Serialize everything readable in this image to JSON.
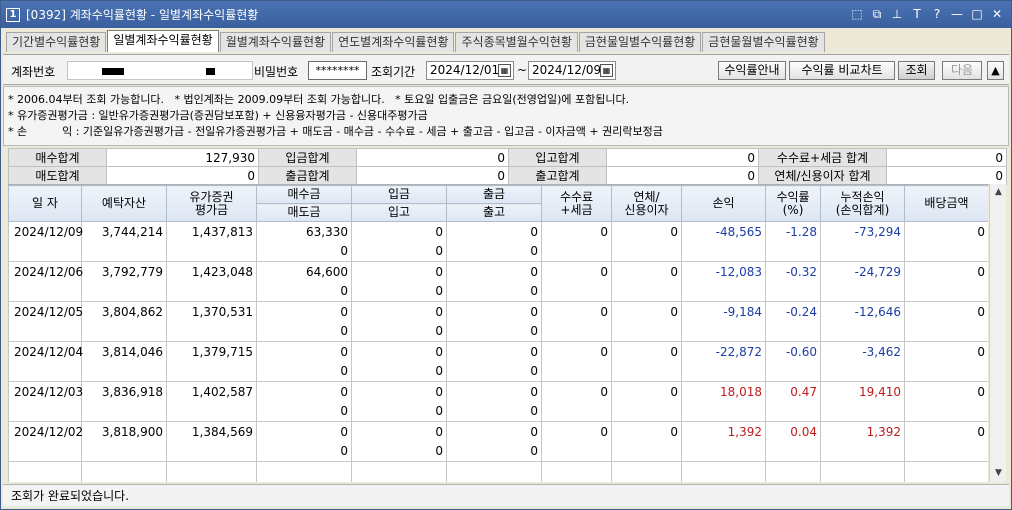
{
  "window": {
    "number": "1",
    "title": "[0392] 계좌수익률현황 - 일별계좌수익률현황",
    "buttons": [
      "⬚",
      "⧉",
      "⊥",
      "T",
      "?",
      "—",
      "□",
      "✕"
    ]
  },
  "tabs": [
    {
      "label": "기간별수익률현황",
      "active": false
    },
    {
      "label": "일별계좌수익률현황",
      "active": true
    },
    {
      "label": "월별계좌수익률현황",
      "active": false
    },
    {
      "label": "연도별계좌수익률현황",
      "active": false
    },
    {
      "label": "주식종목별월수익현황",
      "active": false
    },
    {
      "label": "금현물일별수익률현황",
      "active": false
    },
    {
      "label": "금현물월별수익률현황",
      "active": false
    }
  ],
  "query": {
    "account_label": "계좌번호",
    "password_label": "비밀번호",
    "password_value": "********",
    "period_label": "조회기간",
    "date_from": "2024/12/01",
    "tilde": "~",
    "date_to": "2024/12/09",
    "guide_button": "수익률안내",
    "compare_button": "수익률 비교차트",
    "search_button": "조회",
    "next_button": "다음",
    "up_button": "▲"
  },
  "notice": {
    "line1": "* 2006.04부터 조회 가능합니다.   * 법인계좌는 2009.09부터 조회 가능합니다.   * 토요일 입출금은 금요일(전영업일)에 포함됩니다.",
    "line2": "* 유가증권평가금 : 일반유가증권평가금(증권담보포함) + 신용융자평가금 - 신용대주평가금",
    "line3": "* 손          익 : 기준일유가증권평가금 - 전일유가증권평가금 + 매도금 - 매수금 - 수수료 - 세금 + 출고금 - 입고금 - 이자금액 + 권리락보정금"
  },
  "summary": {
    "row1": [
      {
        "label": "매수합계",
        "value": "127,930"
      },
      {
        "label": "입금합계",
        "value": "0"
      },
      {
        "label": "입고합계",
        "value": "0"
      },
      {
        "label": "수수료+세금 합계",
        "value": "0"
      }
    ],
    "row2": [
      {
        "label": "매도합계",
        "value": "0"
      },
      {
        "label": "출금합계",
        "value": "0"
      },
      {
        "label": "출고합계",
        "value": "0"
      },
      {
        "label": "연체/신용이자 합계",
        "value": "0"
      }
    ]
  },
  "grid": {
    "headers": {
      "date": "일 자",
      "deposit": "예탁자산",
      "securities": "유가증권\n평가금",
      "buy": "매수금",
      "sell": "매도금",
      "deposit_in": "입금",
      "stock_in": "입고",
      "withdraw": "출금",
      "stock_out": "출고",
      "fee": "수수료\n+세금",
      "interest": "연체/\n신용이자",
      "pnl": "손익",
      "rate": "수익률\n(%)",
      "cum": "누적손익\n(손익합계)",
      "dividend": "배당금액"
    },
    "rows": [
      {
        "date": "2024/12/09",
        "deposit": "3,744,214",
        "securities": "1,437,813",
        "buy": "63,330",
        "sell": "0",
        "in": "0",
        "stock_in": "0",
        "out": "0",
        "stock_out": "0",
        "fee": "0",
        "interest": "0",
        "pnl": "-48,565",
        "rate": "-1.28",
        "cum": "-73,294",
        "dividend": "0",
        "pnl_color": "blue",
        "cum_color": "blue"
      },
      {
        "date": "2024/12/06",
        "deposit": "3,792,779",
        "securities": "1,423,048",
        "buy": "64,600",
        "sell": "0",
        "in": "0",
        "stock_in": "0",
        "out": "0",
        "stock_out": "0",
        "fee": "0",
        "interest": "0",
        "pnl": "-12,083",
        "rate": "-0.32",
        "cum": "-24,729",
        "dividend": "0",
        "pnl_color": "blue",
        "cum_color": "blue"
      },
      {
        "date": "2024/12/05",
        "deposit": "3,804,862",
        "securities": "1,370,531",
        "buy": "0",
        "sell": "0",
        "in": "0",
        "stock_in": "0",
        "out": "0",
        "stock_out": "0",
        "fee": "0",
        "interest": "0",
        "pnl": "-9,184",
        "rate": "-0.24",
        "cum": "-12,646",
        "dividend": "0",
        "pnl_color": "blue",
        "cum_color": "blue"
      },
      {
        "date": "2024/12/04",
        "deposit": "3,814,046",
        "securities": "1,379,715",
        "buy": "0",
        "sell": "0",
        "in": "0",
        "stock_in": "0",
        "out": "0",
        "stock_out": "0",
        "fee": "0",
        "interest": "0",
        "pnl": "-22,872",
        "rate": "-0.60",
        "cum": "-3,462",
        "dividend": "0",
        "pnl_color": "blue",
        "cum_color": "blue"
      },
      {
        "date": "2024/12/03",
        "deposit": "3,836,918",
        "securities": "1,402,587",
        "buy": "0",
        "sell": "0",
        "in": "0",
        "stock_in": "0",
        "out": "0",
        "stock_out": "0",
        "fee": "0",
        "interest": "0",
        "pnl": "18,018",
        "rate": "0.47",
        "cum": "19,410",
        "dividend": "0",
        "pnl_color": "red",
        "cum_color": "red"
      },
      {
        "date": "2024/12/02",
        "deposit": "3,818,900",
        "securities": "1,384,569",
        "buy": "0",
        "sell": "0",
        "in": "0",
        "stock_in": "0",
        "out": "0",
        "stock_out": "0",
        "fee": "0",
        "interest": "0",
        "pnl": "1,392",
        "rate": "0.04",
        "cum": "1,392",
        "dividend": "0",
        "pnl_color": "red",
        "cum_color": "red"
      }
    ]
  },
  "status": "조회가 완료되었습니다.",
  "colors": {
    "title_bar": "#3a5f9e",
    "negative": "#1a3ca8",
    "positive": "#c01b1b"
  }
}
